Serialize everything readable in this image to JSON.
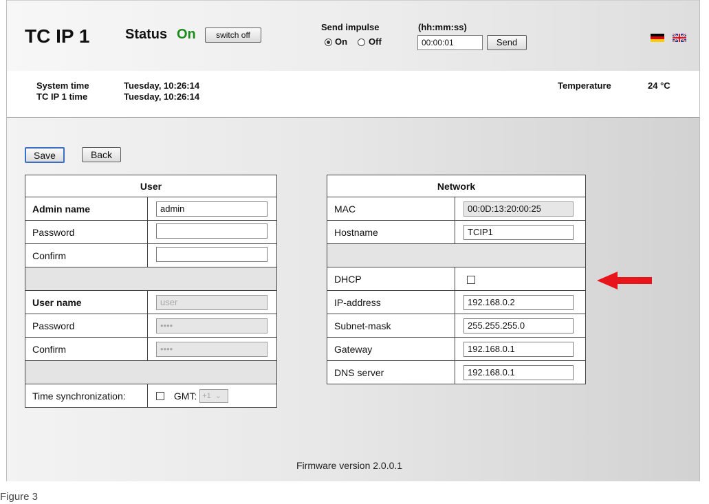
{
  "header": {
    "device_title": "TC IP 1",
    "status_label": "Status",
    "status_value": "On",
    "switch_button": "switch off",
    "send_impulse_label": "Send impulse",
    "radio_on": "On",
    "radio_off": "Off",
    "selected_radio": "On",
    "time_format_label": "(hh:mm:ss)",
    "impulse_time": "00:00:01",
    "send_button": "Send",
    "languages": [
      "German flag",
      "English flag"
    ]
  },
  "system": {
    "system_time_label": "System time",
    "system_time_value": "Tuesday, 10:26:14",
    "device_time_label": "TC IP 1 time",
    "device_time_value": "Tuesday, 10:26:14",
    "temperature_label": "Temperature",
    "temperature_value": "24 °C"
  },
  "actions": {
    "save": "Save",
    "back": "Back"
  },
  "user_panel": {
    "title": "User",
    "admin_name_label": "Admin name",
    "admin_name_value": "admin",
    "admin_password_label": "Password",
    "admin_password_value": "",
    "admin_confirm_label": "Confirm",
    "admin_confirm_value": "",
    "user_name_label": "User name",
    "user_name_value": "user",
    "user_password_label": "Password",
    "user_password_value": "••••",
    "user_confirm_label": "Confirm",
    "user_confirm_value": "••••",
    "time_sync_label": "Time synchronization:",
    "time_sync_checked": false,
    "gmt_label": "GMT:",
    "gmt_value": "+1"
  },
  "network_panel": {
    "title": "Network",
    "mac_label": "MAC",
    "mac_value": "00:0D:13:20:00:25",
    "hostname_label": "Hostname",
    "hostname_value": "TCIP1",
    "dhcp_label": "DHCP",
    "dhcp_checked": false,
    "ip_label": "IP-address",
    "ip_value": "192.168.0.2",
    "subnet_label": "Subnet-mask",
    "subnet_value": "255.255.255.0",
    "gateway_label": "Gateway",
    "gateway_value": "192.168.0.1",
    "dns_label": "DNS server",
    "dns_value": "192.168.0.1"
  },
  "footer": {
    "firmware": "Firmware version 2.0.0.1"
  },
  "caption": "Figure 3",
  "colors": {
    "status_on": "#1a8c1a",
    "arrow": "#e8141c"
  },
  "icons": {
    "annotation": "red-left-arrow"
  }
}
